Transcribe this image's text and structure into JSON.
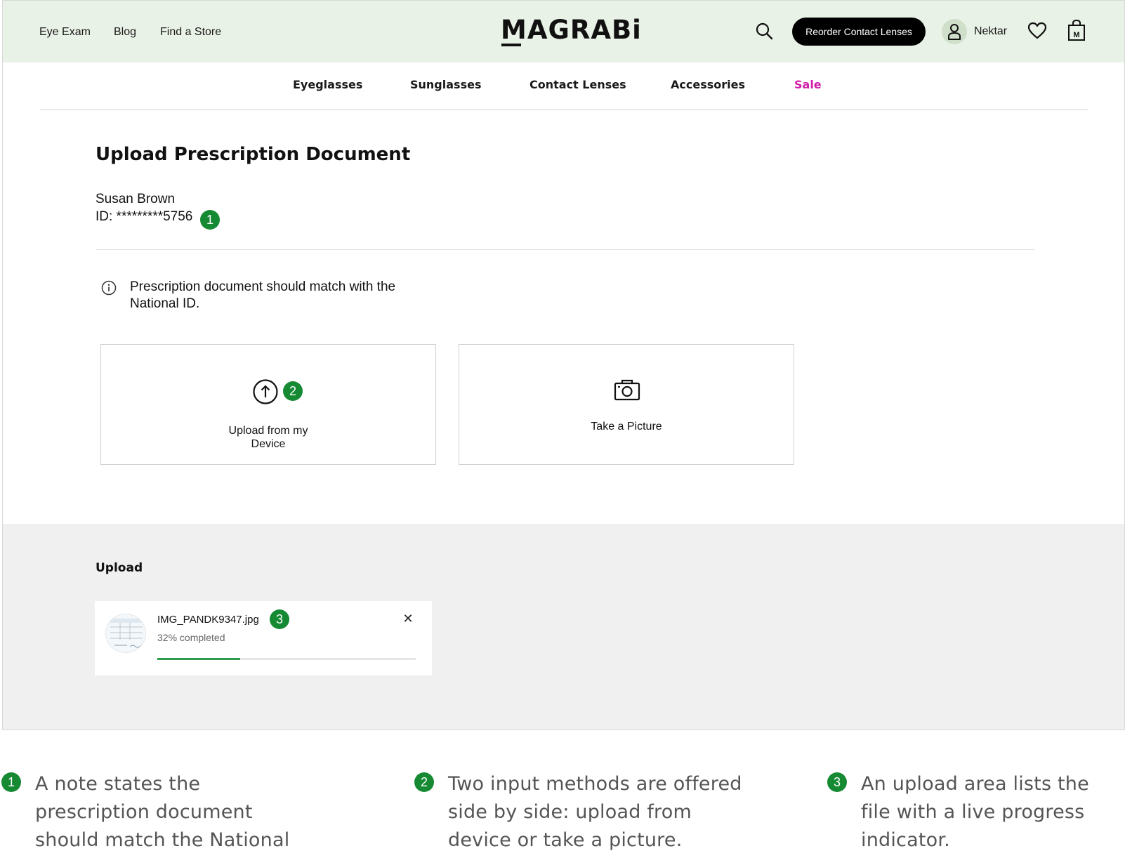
{
  "header": {
    "links": [
      "Eye Exam",
      "Blog",
      "Find a Store"
    ],
    "logo": "MAGRABi",
    "reorder_label": "Reorder Contact Lenses",
    "username": "Nektar",
    "icons": [
      "search-icon",
      "user-icon",
      "heart-icon",
      "bag-icon"
    ]
  },
  "nav": {
    "items": [
      "Eyeglasses",
      "Sunglasses",
      "Contact Lenses",
      "Accessories",
      "Sale"
    ],
    "sale_color": "#d11ea8"
  },
  "page": {
    "title": "Upload Prescription Document",
    "patient_name": "Susan Brown",
    "patient_id": "ID: *********5756",
    "info_text": "Prescription document should match with the National ID.",
    "options": {
      "upload_label": "Upload from my Device",
      "picture_label": "Take a Picture"
    }
  },
  "upload": {
    "heading": "Upload",
    "file_name": "IMG_PANDK9347.jpg",
    "status": "32% completed",
    "progress": 0.32,
    "close_symbol": "✕"
  },
  "badges": [
    "1",
    "2",
    "3"
  ],
  "annotations": [
    "A note states the prescription document should match the National ID.",
    "Two input methods are offered side by side: upload from device or take a picture.",
    "An upload area lists the file with a live progress indicator."
  ],
  "colors": {
    "header_bg": "#e9f2e6",
    "accent_green": "#158a33",
    "progress_green": "#2e9a4c",
    "button_black": "#000000"
  }
}
